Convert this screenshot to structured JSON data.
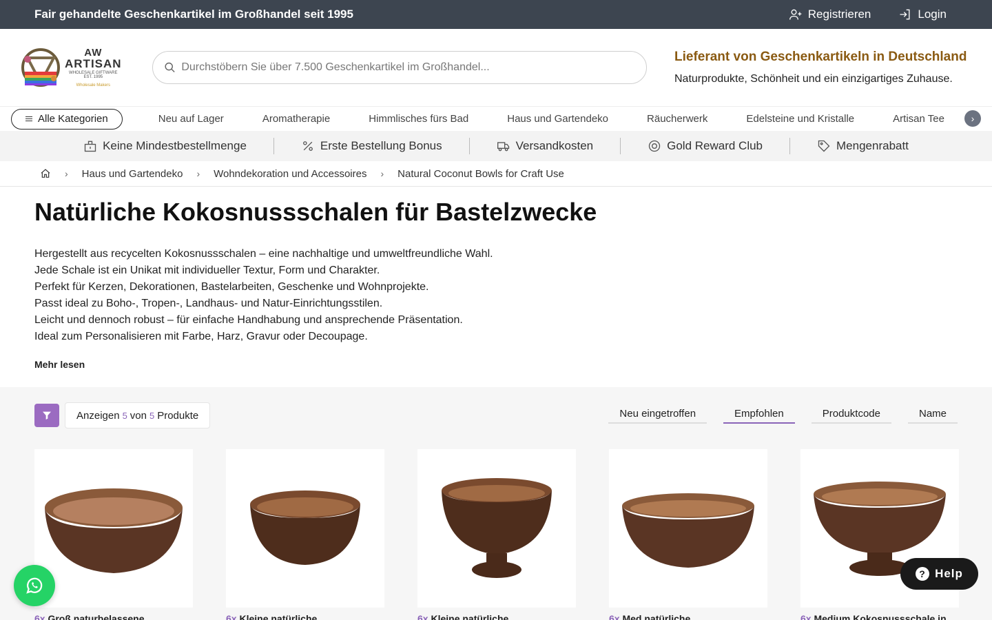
{
  "topbar": {
    "tagline": "Fair gehandelte Geschenkartikel im Großhandel seit 1995",
    "register": "Registrieren",
    "login": "Login"
  },
  "logo": {
    "line1": "AW",
    "line2": "ARTISAN",
    "line3": "WHOLESALE GIFTWARE",
    "line4": "EST. 1995",
    "line5": "Wholesale Makers"
  },
  "search": {
    "placeholder": "Durchstöbern Sie über 7.500 Geschenkartikel im Großhandel..."
  },
  "promo": {
    "headline": "Lieferant von Geschenkartikeln in Deutschland",
    "subline": "Naturprodukte, Schönheit und ein einzigartiges Zuhause."
  },
  "nav": {
    "all": "Alle Kategorien",
    "categories": [
      "Neu auf Lager",
      "Aromatherapie",
      "Himmlisches fürs Bad",
      "Haus und Gartendeko",
      "Räucherwerk",
      "Edelsteine und Kristalle",
      "Artisan Tee"
    ],
    "next": "›"
  },
  "benefits": [
    "Keine Mindestbestellmenge",
    "Erste Bestellung Bonus",
    "Versandkosten",
    "Gold Reward Club",
    "Mengenrabatt"
  ],
  "breadcrumb": [
    "Haus und Gartendeko",
    "Wohndekoration und Accessoires",
    "Natural Coconut Bowls for Craft Use"
  ],
  "page": {
    "title": "Natürliche Kokosnussschalen für Bastelzwecke",
    "description": [
      "Hergestellt aus recycelten Kokosnussschalen – eine nachhaltige und umweltfreundliche Wahl.",
      "Jede Schale ist ein Unikat mit individueller Textur, Form und Charakter.",
      "Perfekt für Kerzen, Dekorationen, Bastelarbeiten, Geschenke und Wohnprojekte.",
      "Passt ideal zu Boho-, Tropen-, Landhaus- und Natur-Einrichtungsstilen.",
      "Leicht und dennoch robust – für einfache Handhabung und ansprechende Präsentation.",
      "Ideal zum Personalisieren mit Farbe, Harz, Gravur oder Decoupage."
    ],
    "more": "Mehr lesen"
  },
  "listing": {
    "show": "Anzeigen",
    "shown": "5",
    "of": "von",
    "total": "5",
    "unit": "Produkte",
    "sorts": [
      "Neu eingetroffen",
      "Empfohlen",
      "Produktcode",
      "Name"
    ],
    "active_sort": 1,
    "products": [
      {
        "qty": "6x",
        "name": "Groß naturbelassene"
      },
      {
        "qty": "6x",
        "name": "Kleine natürliche"
      },
      {
        "qty": "6x",
        "name": "Kleine natürliche"
      },
      {
        "qty": "6x",
        "name": "Med natürliche"
      },
      {
        "qty": "6x",
        "name": "Medium Kokosnussschale in"
      }
    ]
  },
  "help": {
    "label": "Help",
    "icon": "?"
  },
  "colors": {
    "topbar": "#3d4550",
    "accent": "#8a63b8",
    "promo": "#8a5a12",
    "whatsapp": "#25d366"
  }
}
